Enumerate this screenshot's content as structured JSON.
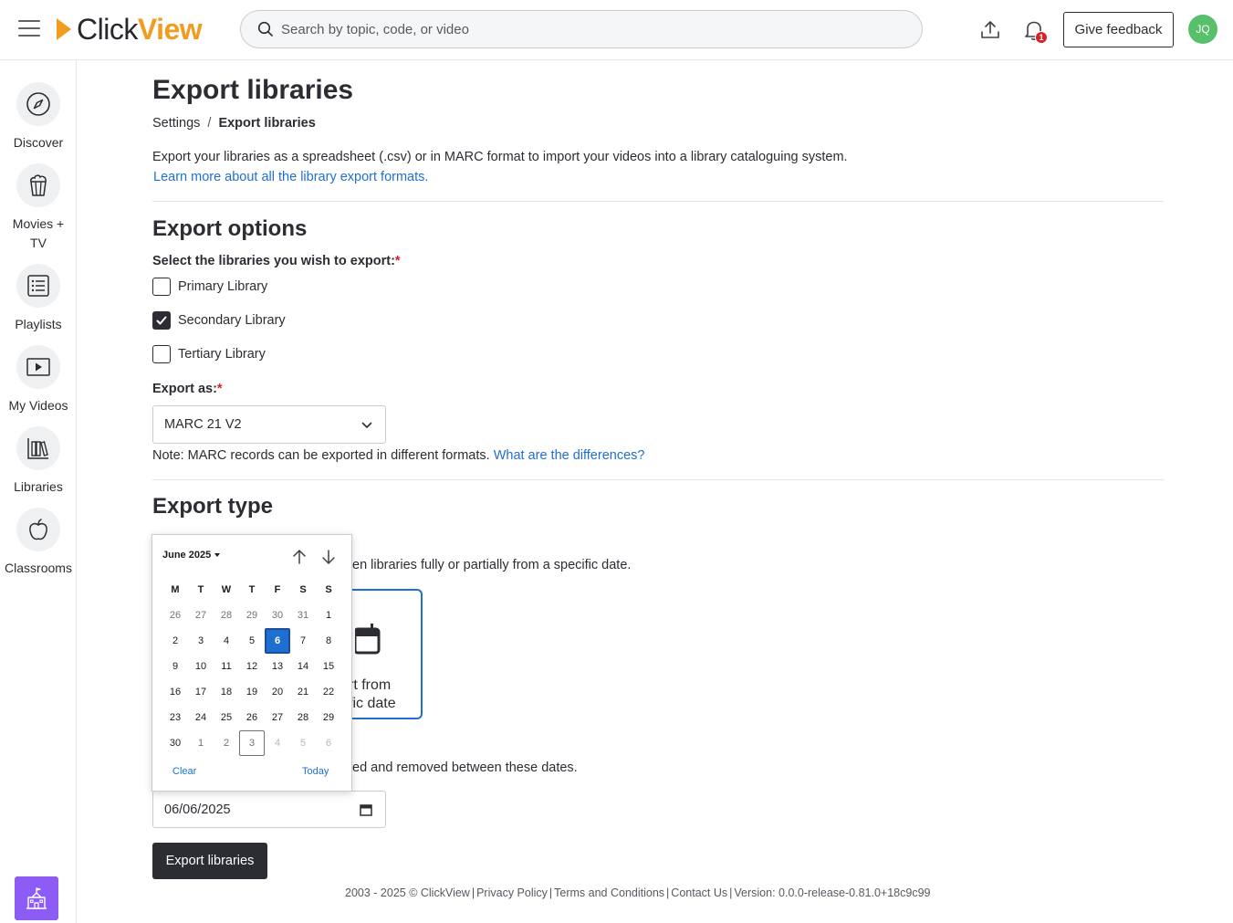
{
  "header": {
    "logo_part1": "Click",
    "logo_part2": "View",
    "search_placeholder": "Search by topic, code, or video",
    "notification_count": "1",
    "feedback_label": "Give feedback",
    "avatar_initials": "JQ"
  },
  "sidebar": {
    "items": [
      {
        "label": "Discover",
        "icon": "compass-icon"
      },
      {
        "label": "Movies + TV",
        "icon": "popcorn-icon"
      },
      {
        "label": "Playlists",
        "icon": "list-icon"
      },
      {
        "label": "My Videos",
        "icon": "play-icon"
      },
      {
        "label": "Libraries",
        "icon": "books-icon"
      },
      {
        "label": "Classrooms",
        "icon": "apple-icon"
      }
    ],
    "bottom_icon": "school-icon"
  },
  "main": {
    "title": "Export libraries",
    "breadcrumb": {
      "parent": "Settings",
      "separator": "/",
      "current": "Export libraries"
    },
    "description": "Export your libraries as a spreadsheet (.csv) or in MARC format to import your videos into a library cataloguing system.",
    "learn_more": "Learn more about all the library export formats.",
    "export_options": {
      "heading": "Export options",
      "libraries_label": "Select the libraries you wish to export:",
      "required_mark": "*",
      "libraries": [
        {
          "label": "Primary Library",
          "checked": false
        },
        {
          "label": "Secondary Library",
          "checked": true
        },
        {
          "label": "Tertiary Library",
          "checked": false
        }
      ],
      "export_as_label": "Export as:",
      "export_as_value": "MARC 21 V2",
      "note_text": "Note: MARC records can be exported in different formats.",
      "note_link": "What are the differences?"
    },
    "export_type": {
      "heading": "Export type",
      "partial_desc": "en libraries fully or partially from a specific date.",
      "card_line1": "rt from",
      "card_line2": "fic date",
      "date_desc_partial": "ted and removed between these dates.",
      "date_value": "06/06/2025"
    },
    "export_button": "Export libraries"
  },
  "calendar": {
    "month_label": "June 2025",
    "weekdays": [
      "M",
      "T",
      "W",
      "T",
      "F",
      "S",
      "S"
    ],
    "weeks": [
      [
        "26",
        "27",
        "28",
        "29",
        "30",
        "31",
        "1"
      ],
      [
        "2",
        "3",
        "4",
        "5",
        "6",
        "7",
        "8"
      ],
      [
        "9",
        "10",
        "11",
        "12",
        "13",
        "14",
        "15"
      ],
      [
        "16",
        "17",
        "18",
        "19",
        "20",
        "21",
        "22"
      ],
      [
        "23",
        "24",
        "25",
        "26",
        "27",
        "28",
        "29"
      ],
      [
        "30",
        "1",
        "2",
        "3",
        "4",
        "5",
        "6"
      ]
    ],
    "selected_day": "6",
    "today_day": "3",
    "clear_label": "Clear",
    "today_label": "Today"
  },
  "footer": {
    "copyright": "2003 - 2025 © ClickView",
    "links": [
      "Privacy Policy",
      "Terms and Conditions",
      "Contact Us"
    ],
    "version": "Version: 0.0.0-release-0.81.0+18c9c99"
  },
  "colors": {
    "accent": "#1f6fd1",
    "brand_orange": "#f29c1f",
    "dark_button": "#2b2d33",
    "required": "#d6232b",
    "avatar": "#58bf6b",
    "school_button": "#8c5cf5"
  }
}
